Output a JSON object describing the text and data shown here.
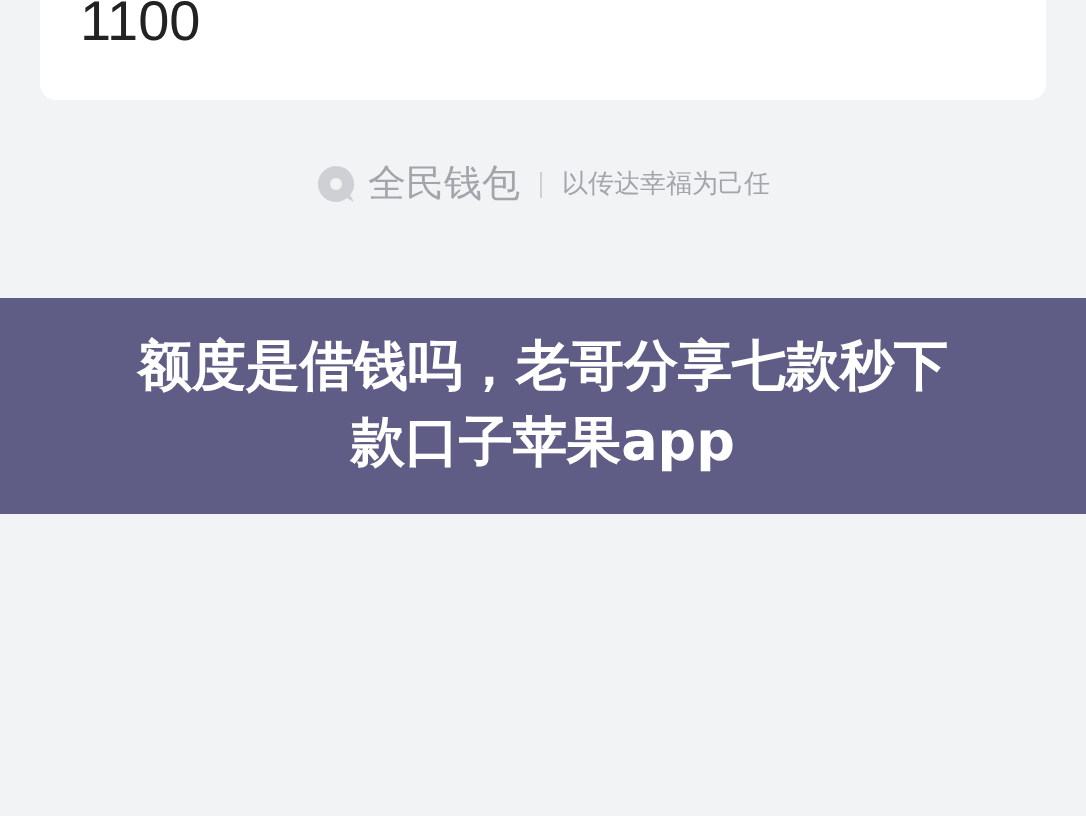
{
  "card": {
    "amount": "1100"
  },
  "brand": {
    "name": "全民钱包",
    "slogan": "以传达幸福为己任"
  },
  "banner": {
    "title": "额度是借钱吗，老哥分享七款秒下款口子苹果app"
  }
}
